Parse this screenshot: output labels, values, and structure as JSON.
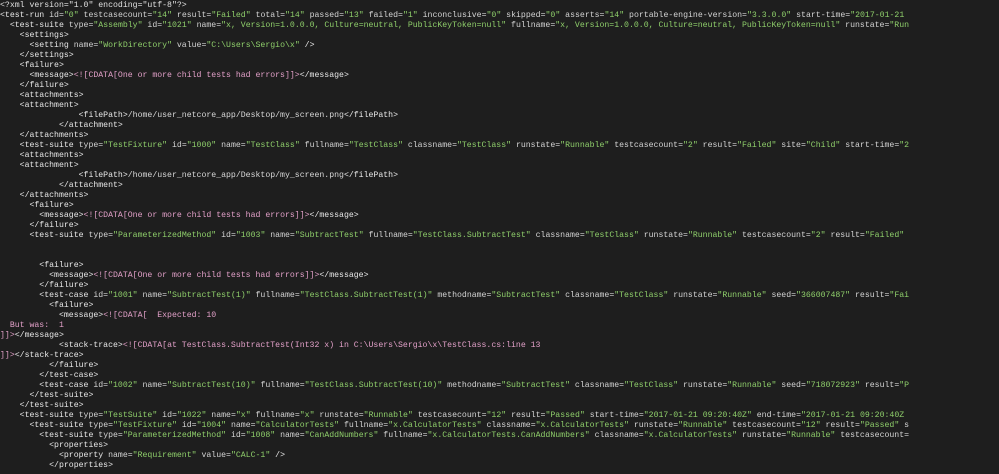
{
  "editor": {
    "lines": [
      [
        {
          "c": "pi",
          "t": "<?xml version=\"1.0\" encoding=\"utf-8\"?>"
        }
      ],
      [
        {
          "c": "tag",
          "t": "<test-run "
        },
        {
          "c": "attr",
          "t": "id="
        },
        {
          "c": "val",
          "t": "\"0\""
        },
        {
          "c": "attr",
          "t": " testcasecount="
        },
        {
          "c": "val",
          "t": "\"14\""
        },
        {
          "c": "attr",
          "t": " result="
        },
        {
          "c": "val",
          "t": "\"Failed\""
        },
        {
          "c": "attr",
          "t": " total="
        },
        {
          "c": "val",
          "t": "\"14\""
        },
        {
          "c": "attr",
          "t": " passed="
        },
        {
          "c": "val",
          "t": "\"13\""
        },
        {
          "c": "attr",
          "t": " failed="
        },
        {
          "c": "val",
          "t": "\"1\""
        },
        {
          "c": "attr",
          "t": " inconclusive="
        },
        {
          "c": "val",
          "t": "\"0\""
        },
        {
          "c": "attr",
          "t": " skipped="
        },
        {
          "c": "val",
          "t": "\"0\""
        },
        {
          "c": "attr",
          "t": " asserts="
        },
        {
          "c": "val",
          "t": "\"14\""
        },
        {
          "c": "attr",
          "t": " portable-engine-version="
        },
        {
          "c": "val",
          "t": "\"3.3.0.0\""
        },
        {
          "c": "attr",
          "t": " start-time="
        },
        {
          "c": "val",
          "t": "\"2017-01-21"
        }
      ],
      [
        {
          "c": "tag",
          "t": "  <test-suite "
        },
        {
          "c": "attr",
          "t": "type="
        },
        {
          "c": "val",
          "t": "\"Assembly\""
        },
        {
          "c": "attr",
          "t": " id="
        },
        {
          "c": "val",
          "t": "\"1021\""
        },
        {
          "c": "attr",
          "t": " name="
        },
        {
          "c": "val",
          "t": "\"x, Version=1.0.0.0, Culture=neutral, PublicKeyToken=null\""
        },
        {
          "c": "attr",
          "t": " fullname="
        },
        {
          "c": "val",
          "t": "\"x, Version=1.0.0.0, Culture=neutral, PublicKeyToken=null\""
        },
        {
          "c": "attr",
          "t": " runstate="
        },
        {
          "c": "val",
          "t": "\"Run"
        }
      ],
      [
        {
          "c": "tag",
          "t": "    <settings>"
        }
      ],
      [
        {
          "c": "tag",
          "t": "      <setting "
        },
        {
          "c": "attr",
          "t": "name="
        },
        {
          "c": "val",
          "t": "\"WorkDirectory\""
        },
        {
          "c": "attr",
          "t": " value="
        },
        {
          "c": "val",
          "t": "\"C:\\Users\\Sergio\\x\""
        },
        {
          "c": "tag",
          "t": " />"
        }
      ],
      [
        {
          "c": "tag",
          "t": "    </settings>"
        }
      ],
      [
        {
          "c": "tag",
          "t": "    <failure>"
        }
      ],
      [
        {
          "c": "tag",
          "t": "      <message>"
        },
        {
          "c": "cdata",
          "t": "<![CDATA[One or more child tests had errors]]>"
        },
        {
          "c": "tag",
          "t": "</message>"
        }
      ],
      [
        {
          "c": "tag",
          "t": "    </failure>"
        }
      ],
      [
        {
          "c": "tag",
          "t": "    <attachments>"
        }
      ],
      [
        {
          "c": "tag",
          "t": "    <attachment>"
        }
      ],
      [
        {
          "c": "tag",
          "t": "                <filePath>"
        },
        {
          "c": "txt",
          "t": "/home/user_netcore_app/Desktop/my_screen.png"
        },
        {
          "c": "tag",
          "t": "</filePath>"
        }
      ],
      [
        {
          "c": "tag",
          "t": "            </attachment>"
        }
      ],
      [
        {
          "c": "tag",
          "t": "    </attachments>"
        }
      ],
      [
        {
          "c": "tag",
          "t": "    <test-suite "
        },
        {
          "c": "attr",
          "t": "type="
        },
        {
          "c": "val",
          "t": "\"TestFixture\""
        },
        {
          "c": "attr",
          "t": " id="
        },
        {
          "c": "val",
          "t": "\"1000\""
        },
        {
          "c": "attr",
          "t": " name="
        },
        {
          "c": "val",
          "t": "\"TestClass\""
        },
        {
          "c": "attr",
          "t": " fullname="
        },
        {
          "c": "val",
          "t": "\"TestClass\""
        },
        {
          "c": "attr",
          "t": " classname="
        },
        {
          "c": "val",
          "t": "\"TestClass\""
        },
        {
          "c": "attr",
          "t": " runstate="
        },
        {
          "c": "val",
          "t": "\"Runnable\""
        },
        {
          "c": "attr",
          "t": " testcasecount="
        },
        {
          "c": "val",
          "t": "\"2\""
        },
        {
          "c": "attr",
          "t": " result="
        },
        {
          "c": "val",
          "t": "\"Failed\""
        },
        {
          "c": "attr",
          "t": " site="
        },
        {
          "c": "val",
          "t": "\"Child\""
        },
        {
          "c": "attr",
          "t": " start-time="
        },
        {
          "c": "val",
          "t": "\"2"
        }
      ],
      [
        {
          "c": "tag",
          "t": "    <attachments>"
        }
      ],
      [
        {
          "c": "tag",
          "t": "    <attachment>"
        }
      ],
      [
        {
          "c": "tag",
          "t": "                <filePath>"
        },
        {
          "c": "txt",
          "t": "/home/user_netcore_app/Desktop/my_screen.png"
        },
        {
          "c": "tag",
          "t": "</filePath>"
        }
      ],
      [
        {
          "c": "tag",
          "t": "            </attachment>"
        }
      ],
      [
        {
          "c": "tag",
          "t": "    </attachments>"
        }
      ],
      [
        {
          "c": "tag",
          "t": "      <failure>"
        }
      ],
      [
        {
          "c": "tag",
          "t": "        <message>"
        },
        {
          "c": "cdata",
          "t": "<![CDATA[One or more child tests had errors]]>"
        },
        {
          "c": "tag",
          "t": "</message>"
        }
      ],
      [
        {
          "c": "tag",
          "t": "      </failure>"
        }
      ],
      [
        {
          "c": "tag",
          "t": "      <test-suite "
        },
        {
          "c": "attr",
          "t": "type="
        },
        {
          "c": "val",
          "t": "\"ParameterizedMethod\""
        },
        {
          "c": "attr",
          "t": " id="
        },
        {
          "c": "val",
          "t": "\"1003\""
        },
        {
          "c": "attr",
          "t": " name="
        },
        {
          "c": "val",
          "t": "\"SubtractTest\""
        },
        {
          "c": "attr",
          "t": " fullname="
        },
        {
          "c": "val",
          "t": "\"TestClass.SubtractTest\""
        },
        {
          "c": "attr",
          "t": " classname="
        },
        {
          "c": "val",
          "t": "\"TestClass\""
        },
        {
          "c": "attr",
          "t": " runstate="
        },
        {
          "c": "val",
          "t": "\"Runnable\""
        },
        {
          "c": "attr",
          "t": " testcasecount="
        },
        {
          "c": "val",
          "t": "\"2\""
        },
        {
          "c": "attr",
          "t": " result="
        },
        {
          "c": "val",
          "t": "\"Failed\""
        }
      ],
      [],
      [],
      [
        {
          "c": "tag",
          "t": "        <failure>"
        }
      ],
      [
        {
          "c": "tag",
          "t": "          <message>"
        },
        {
          "c": "cdata",
          "t": "<![CDATA[One or more child tests had errors]]>"
        },
        {
          "c": "tag",
          "t": "</message>"
        }
      ],
      [
        {
          "c": "tag",
          "t": "        </failure>"
        }
      ],
      [
        {
          "c": "tag",
          "t": "        <test-case "
        },
        {
          "c": "attr",
          "t": "id="
        },
        {
          "c": "val",
          "t": "\"1001\""
        },
        {
          "c": "attr",
          "t": " name="
        },
        {
          "c": "val",
          "t": "\"SubtractTest(1)\""
        },
        {
          "c": "attr",
          "t": " fullname="
        },
        {
          "c": "val",
          "t": "\"TestClass.SubtractTest(1)\""
        },
        {
          "c": "attr",
          "t": " methodname="
        },
        {
          "c": "val",
          "t": "\"SubtractTest\""
        },
        {
          "c": "attr",
          "t": " classname="
        },
        {
          "c": "val",
          "t": "\"TestClass\""
        },
        {
          "c": "attr",
          "t": " runstate="
        },
        {
          "c": "val",
          "t": "\"Runnable\""
        },
        {
          "c": "attr",
          "t": " seed="
        },
        {
          "c": "val",
          "t": "\"366007487\""
        },
        {
          "c": "attr",
          "t": " result="
        },
        {
          "c": "val",
          "t": "\"Fai"
        }
      ],
      [
        {
          "c": "tag",
          "t": "          <failure>"
        }
      ],
      [
        {
          "c": "tag",
          "t": "            <message>"
        },
        {
          "c": "cdata",
          "t": "<![CDATA[  Expected: 10"
        }
      ],
      [
        {
          "c": "cdata",
          "t": "  But was:  1"
        }
      ],
      [
        {
          "c": "cdata",
          "t": "]]>"
        },
        {
          "c": "tag",
          "t": "</message>"
        }
      ],
      [
        {
          "c": "tag",
          "t": "            <stack-trace>"
        },
        {
          "c": "cdata",
          "t": "<![CDATA[at TestClass.SubtractTest(Int32 x) in C:\\Users\\Sergio\\x\\TestClass.cs:line 13"
        }
      ],
      [
        {
          "c": "cdata",
          "t": "]]>"
        },
        {
          "c": "tag",
          "t": "</stack-trace>"
        }
      ],
      [
        {
          "c": "tag",
          "t": "          </failure>"
        }
      ],
      [
        {
          "c": "tag",
          "t": "        </test-case>"
        }
      ],
      [
        {
          "c": "tag",
          "t": "        <test-case "
        },
        {
          "c": "attr",
          "t": "id="
        },
        {
          "c": "val",
          "t": "\"1002\""
        },
        {
          "c": "attr",
          "t": " name="
        },
        {
          "c": "val",
          "t": "\"SubtractTest(10)\""
        },
        {
          "c": "attr",
          "t": " fullname="
        },
        {
          "c": "val",
          "t": "\"TestClass.SubtractTest(10)\""
        },
        {
          "c": "attr",
          "t": " methodname="
        },
        {
          "c": "val",
          "t": "\"SubtractTest\""
        },
        {
          "c": "attr",
          "t": " classname="
        },
        {
          "c": "val",
          "t": "\"TestClass\""
        },
        {
          "c": "attr",
          "t": " runstate="
        },
        {
          "c": "val",
          "t": "\"Runnable\""
        },
        {
          "c": "attr",
          "t": " seed="
        },
        {
          "c": "val",
          "t": "\"718072923\""
        },
        {
          "c": "attr",
          "t": " result="
        },
        {
          "c": "val",
          "t": "\"P"
        }
      ],
      [
        {
          "c": "tag",
          "t": "      </test-suite>"
        }
      ],
      [
        {
          "c": "tag",
          "t": "    </test-suite>"
        }
      ],
      [
        {
          "c": "tag",
          "t": "    <test-suite "
        },
        {
          "c": "attr",
          "t": "type="
        },
        {
          "c": "val",
          "t": "\"TestSuite\""
        },
        {
          "c": "attr",
          "t": " id="
        },
        {
          "c": "val",
          "t": "\"1022\""
        },
        {
          "c": "attr",
          "t": " name="
        },
        {
          "c": "val",
          "t": "\"x\""
        },
        {
          "c": "attr",
          "t": " fullname="
        },
        {
          "c": "val",
          "t": "\"x\""
        },
        {
          "c": "attr",
          "t": " runstate="
        },
        {
          "c": "val",
          "t": "\"Runnable\""
        },
        {
          "c": "attr",
          "t": " testcasecount="
        },
        {
          "c": "val",
          "t": "\"12\""
        },
        {
          "c": "attr",
          "t": " result="
        },
        {
          "c": "val",
          "t": "\"Passed\""
        },
        {
          "c": "attr",
          "t": " start-time="
        },
        {
          "c": "val",
          "t": "\"2017-01-21 09:20:40Z\""
        },
        {
          "c": "attr",
          "t": " end-time="
        },
        {
          "c": "val",
          "t": "\"2017-01-21 09:20:40Z"
        }
      ],
      [
        {
          "c": "tag",
          "t": "      <test-suite "
        },
        {
          "c": "attr",
          "t": "type="
        },
        {
          "c": "val",
          "t": "\"TestFixture\""
        },
        {
          "c": "attr",
          "t": " id="
        },
        {
          "c": "val",
          "t": "\"1004\""
        },
        {
          "c": "attr",
          "t": " name="
        },
        {
          "c": "val",
          "t": "\"CalculatorTests\""
        },
        {
          "c": "attr",
          "t": " fullname="
        },
        {
          "c": "val",
          "t": "\"x.CalculatorTests\""
        },
        {
          "c": "attr",
          "t": " classname="
        },
        {
          "c": "val",
          "t": "\"x.CalculatorTests\""
        },
        {
          "c": "attr",
          "t": " runstate="
        },
        {
          "c": "val",
          "t": "\"Runnable\""
        },
        {
          "c": "attr",
          "t": " testcasecount="
        },
        {
          "c": "val",
          "t": "\"12\""
        },
        {
          "c": "attr",
          "t": " result="
        },
        {
          "c": "val",
          "t": "\"Passed\""
        },
        {
          "c": "attr",
          "t": " s"
        }
      ],
      [
        {
          "c": "tag",
          "t": "        <test-suite "
        },
        {
          "c": "attr",
          "t": "type="
        },
        {
          "c": "val",
          "t": "\"ParameterizedMethod\""
        },
        {
          "c": "attr",
          "t": " id="
        },
        {
          "c": "val",
          "t": "\"1008\""
        },
        {
          "c": "attr",
          "t": " name="
        },
        {
          "c": "val",
          "t": "\"CanAddNumbers\""
        },
        {
          "c": "attr",
          "t": " fullname="
        },
        {
          "c": "val",
          "t": "\"x.CalculatorTests.CanAddNumbers\""
        },
        {
          "c": "attr",
          "t": " classname="
        },
        {
          "c": "val",
          "t": "\"x.CalculatorTests\""
        },
        {
          "c": "attr",
          "t": " runstate="
        },
        {
          "c": "val",
          "t": "\"Runnable\""
        },
        {
          "c": "attr",
          "t": " testcasecount="
        }
      ],
      [
        {
          "c": "tag",
          "t": "          <properties>"
        }
      ],
      [
        {
          "c": "tag",
          "t": "            <property "
        },
        {
          "c": "attr",
          "t": "name="
        },
        {
          "c": "val",
          "t": "\"Requirement\""
        },
        {
          "c": "attr",
          "t": " value="
        },
        {
          "c": "val",
          "t": "\"CALC-1\""
        },
        {
          "c": "tag",
          "t": " />"
        }
      ],
      [
        {
          "c": "tag",
          "t": "          </properties>"
        }
      ]
    ]
  }
}
